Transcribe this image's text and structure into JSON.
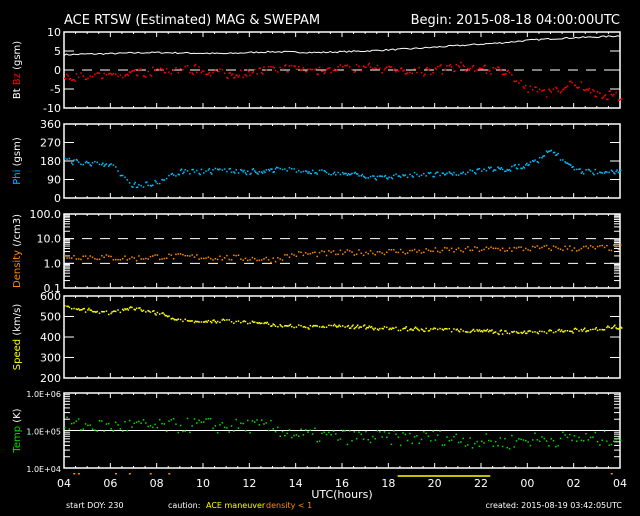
{
  "title": "ACE RTSW (Estimated) MAG & SWEPAM",
  "begin": "Begin: 2015-08-18 04:00:00UTC",
  "footer": {
    "start_doy": "start DOY: 230",
    "caution": "caution:",
    "maneuver": "ACE maneuver",
    "density_flag": "density < 1",
    "created": "created: 2015-08-19 03:42:05UTC"
  },
  "colors": {
    "white": "#ffffff",
    "bz": "#ff0000",
    "phi": "#00bfff",
    "density": "#ff8c00",
    "speed": "#ffff00",
    "temp": "#00e000"
  },
  "chart_data": {
    "type": "scatter",
    "xlabel": "UTC(hours)",
    "x_tick_labels": [
      "04",
      "06",
      "08",
      "10",
      "12",
      "14",
      "16",
      "18",
      "20",
      "22",
      "00",
      "02",
      "04"
    ],
    "x_range_hours": [
      0,
      24
    ],
    "maneuver_hours": [
      14.4,
      18.4
    ],
    "density_lt1_hours": [
      0.4,
      0.6,
      2.2,
      2.8,
      3.7,
      4.5,
      23.6
    ],
    "hourly_x": [
      0,
      1,
      2,
      3,
      4,
      5,
      6,
      7,
      8,
      9,
      10,
      11,
      12,
      13,
      14,
      15,
      16,
      17,
      18,
      19,
      20,
      21,
      22,
      23,
      24
    ],
    "panels": [
      {
        "name": "bt-bz",
        "ylabel_parts": [
          "Bt",
          "Bz",
          "(gsm)"
        ],
        "yscale": "linear",
        "ylim": [
          -10,
          10
        ],
        "tick_labels": [
          "10",
          "5",
          "0",
          "-5",
          "-10"
        ],
        "tick_values": [
          10,
          5,
          0,
          -5,
          -10
        ],
        "dashed": [
          0
        ],
        "series": [
          {
            "name": "Bt",
            "color": "white",
            "line": true,
            "values": [
              4,
              4.2,
              4.3,
              4.5,
              4.6,
              4.5,
              4.4,
              4.3,
              4.6,
              4.8,
              4.7,
              4.6,
              4.8,
              5,
              5.3,
              5.6,
              6,
              6.4,
              6.8,
              7.2,
              7.8,
              8.2,
              8.5,
              8.7,
              9
            ]
          },
          {
            "name": "Bz",
            "color": "bz",
            "line": false,
            "spread": 1.2,
            "values": [
              -1,
              -2,
              -1.5,
              -1,
              0,
              0.5,
              0,
              -1,
              -0.5,
              0.5,
              0.5,
              0,
              1,
              0.5,
              0,
              -0.5,
              0,
              1,
              0.5,
              0,
              -5,
              -6,
              -3,
              -6,
              -7
            ]
          }
        ]
      },
      {
        "name": "phi",
        "ylabel_parts": [
          "Phi",
          "(gsm)"
        ],
        "yscale": "linear",
        "ylim": [
          0,
          360
        ],
        "tick_labels": [
          "360",
          "270",
          "180",
          "90",
          "0"
        ],
        "tick_values": [
          360,
          270,
          180,
          90,
          0
        ],
        "dashed": [],
        "series": [
          {
            "name": "Phi",
            "color": "phi",
            "spread": 12,
            "values": [
              190,
              175,
              165,
              60,
              80,
              130,
              135,
              140,
              130,
              140,
              140,
              130,
              120,
              110,
              110,
              115,
              120,
              125,
              140,
              145,
              160,
              240,
              135,
              130,
              135
            ]
          }
        ]
      },
      {
        "name": "density",
        "ylabel_parts": [
          "Density",
          "(/cm3)"
        ],
        "yscale": "log",
        "ylim": [
          0.1,
          100
        ],
        "tick_labels": [
          "100.0",
          "10.0",
          "1.0",
          "0.1"
        ],
        "tick_values": [
          100,
          10,
          1,
          0.1
        ],
        "dashed": [
          10,
          1
        ],
        "series": [
          {
            "name": "Density",
            "color": "density",
            "spread": 0.12,
            "values": [
              2,
              2,
              1.8,
              1.7,
              2,
              2,
              1.9,
              1.8,
              1.7,
              1.5,
              2.5,
              2.6,
              2.8,
              3,
              3.2,
              3.3,
              3.5,
              3.7,
              4,
              4,
              4.2,
              4.5,
              4.3,
              4.5,
              4.5
            ]
          }
        ]
      },
      {
        "name": "speed",
        "ylabel_parts": [
          "Speed",
          "(km/s)"
        ],
        "yscale": "linear",
        "ylim": [
          200,
          600
        ],
        "tick_labels": [
          "600",
          "500",
          "400",
          "300",
          "200"
        ],
        "tick_values": [
          600,
          500,
          400,
          300,
          200
        ],
        "dashed": [],
        "series": [
          {
            "name": "Speed",
            "color": "speed",
            "spread": 8,
            "values": [
              550,
              530,
              520,
              545,
              520,
              485,
              480,
              480,
              475,
              460,
              455,
              455,
              450,
              450,
              445,
              440,
              440,
              435,
              430,
              425,
              430,
              430,
              435,
              440,
              450
            ]
          }
        ]
      },
      {
        "name": "temp",
        "ylabel_parts": [
          "Temp",
          "(K)"
        ],
        "yscale": "log",
        "ylim": [
          10000,
          1000000
        ],
        "tick_labels": [
          "1.0E+06",
          "1.0E+05",
          "1.0E+04"
        ],
        "tick_values": [
          1000000,
          100000,
          10000
        ],
        "solid": [
          100000
        ],
        "series": [
          {
            "name": "Temp",
            "color": "temp",
            "spread": 0.2,
            "values": [
              150000,
              140000,
              130000,
              140000,
              130000,
              140000,
              150000,
              130000,
              140000,
              120000,
              80000,
              75000,
              70000,
              70000,
              65000,
              65000,
              70000,
              60000,
              55000,
              50000,
              60000,
              60000,
              65000,
              60000,
              70000
            ]
          }
        ]
      }
    ]
  }
}
